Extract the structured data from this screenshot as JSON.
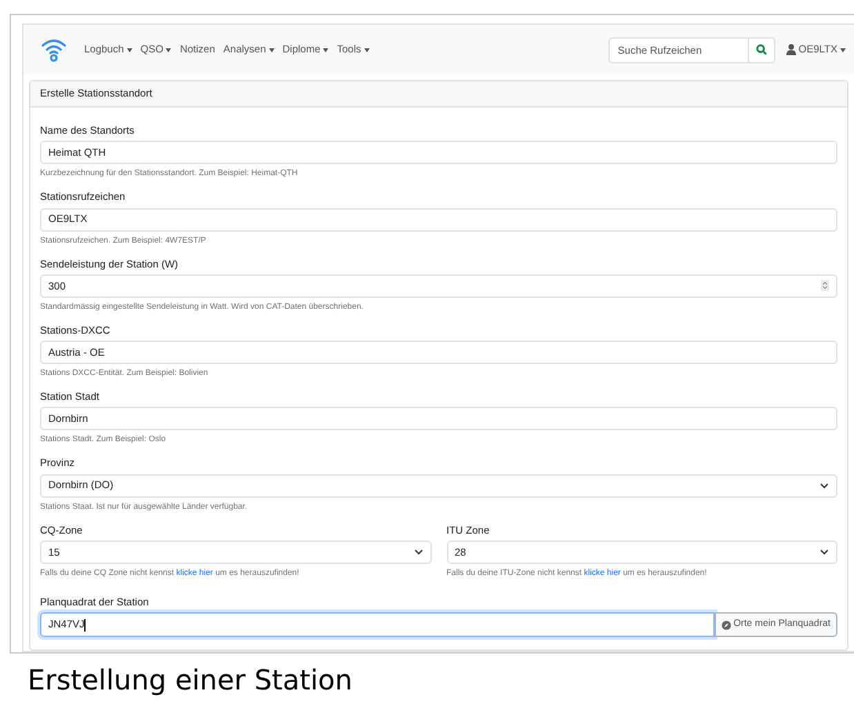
{
  "navbar": {
    "menu": [
      {
        "label": "Logbuch",
        "dropdown": true
      },
      {
        "label": "QSO",
        "dropdown": true
      },
      {
        "label": "Notizen",
        "dropdown": false
      },
      {
        "label": "Analysen",
        "dropdown": true
      },
      {
        "label": "Diplome",
        "dropdown": true
      },
      {
        "label": "Tools",
        "dropdown": true
      }
    ],
    "search": {
      "placeholder": "Suche Rufzeichen"
    },
    "user": {
      "label": "OE9LTX"
    }
  },
  "card": {
    "title": "Erstelle Stationsstandort",
    "fields": [
      {
        "kind": "text",
        "label": "Name des Standorts",
        "value": "Heimat QTH",
        "help": {
          "text": "Kurzbezeichnung für den Stationsstandort. Zum Beispiel: Heimat-QTH"
        }
      },
      {
        "kind": "text",
        "label": "Stationsrufzeichen",
        "value": "OE9LTX",
        "help": {
          "text": "Stationsrufzeichen. Zum Beispiel: 4W7EST/P"
        }
      },
      {
        "kind": "number",
        "label": "Sendeleistung der Station (W)",
        "value": "300",
        "help": {
          "text": "Standardmässig eingestellte Sendeleistung in Watt. Wird von CAT-Daten überschrieben."
        }
      },
      {
        "kind": "text",
        "label": "Stations-DXCC",
        "value": "Austria - OE",
        "help": {
          "text": "Stations DXCC-Entität. Zum Beispiel: Bolivien"
        }
      },
      {
        "kind": "text",
        "label": "Station Stadt",
        "value": "Dornbirn",
        "help": {
          "text": "Stations Stadt. Zum Beispiel: Oslo"
        }
      },
      {
        "kind": "select",
        "label": "Provinz",
        "value": "Dornbirn (DO)",
        "help": {
          "text": "Stations Staat. Ist nur für ausgewählte Länder verfügbar."
        }
      }
    ],
    "zones": [
      {
        "label": "CQ-Zone",
        "value": "15",
        "help": {
          "text": "Falls du deine CQ Zone nicht kennst",
          "link": "klicke hier",
          "after": "um es herauszufinden!"
        }
      },
      {
        "label": "ITU Zone",
        "value": "28",
        "help": {
          "text": "Falls du deine ITU-Zone nicht kennst",
          "link": "klicke hier",
          "after": "um es herauszufinden!"
        }
      }
    ],
    "locator": {
      "label": "Planquadrat der Station",
      "value": "JN47VJ",
      "focused": true,
      "button": "Orte mein Planquadrat"
    }
  },
  "caption": "Erstellung einer Station"
}
